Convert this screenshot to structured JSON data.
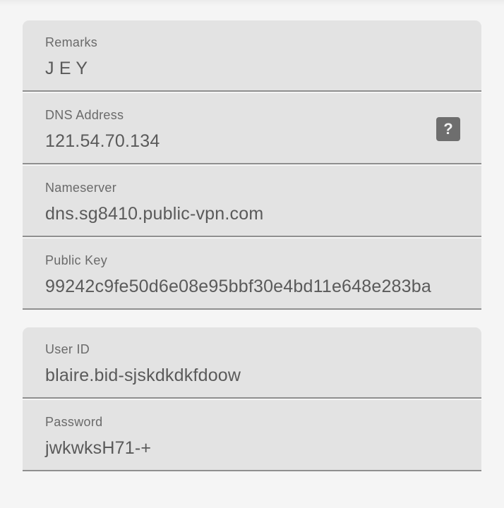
{
  "server_group": {
    "fields": [
      {
        "label": "Remarks",
        "value": "J E Y"
      },
      {
        "label": "DNS Address",
        "value": "121.54.70.134",
        "help_icon": "?"
      },
      {
        "label": "Nameserver",
        "value": "dns.sg8410.public-vpn.com"
      },
      {
        "label": "Public Key",
        "value": "99242c9fe50d6e08e95bbf30e4bd11e648e283ba"
      }
    ]
  },
  "account_group": {
    "fields": [
      {
        "label": "User ID",
        "value": "blaire.bid-sjskdkdkfdoow"
      },
      {
        "label": "Password",
        "value": "jwkwksH71-+"
      }
    ]
  },
  "colors": {
    "page_background": "#f5f5f5",
    "field_background": "#e3e3e3",
    "underline": "#8f8f8f",
    "label_text": "#6a6a6a",
    "value_text": "#5a5a5a",
    "help_icon_background": "#6e6e6e"
  },
  "icons": {
    "help": "help-icon"
  }
}
